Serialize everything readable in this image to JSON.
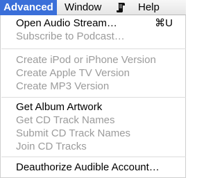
{
  "menubar": {
    "items": [
      {
        "label": "Advanced"
      },
      {
        "label": "Window"
      },
      {
        "label": "Help"
      }
    ],
    "script_icon": "script-scroll-icon"
  },
  "menu": {
    "group1": {
      "open_audio_stream": {
        "label": "Open Audio Stream…",
        "shortcut": "⌘U",
        "enabled": true
      },
      "subscribe_podcast": {
        "label": "Subscribe to Podcast…",
        "enabled": false
      }
    },
    "group2": {
      "create_ipod": {
        "label": "Create iPod or iPhone Version",
        "enabled": false
      },
      "create_appletv": {
        "label": "Create Apple TV Version",
        "enabled": false
      },
      "create_mp3": {
        "label": "Create MP3 Version",
        "enabled": false
      }
    },
    "group3": {
      "get_album_artwork": {
        "label": "Get Album Artwork",
        "enabled": true
      },
      "get_cd_track_names": {
        "label": "Get CD Track Names",
        "enabled": false
      },
      "submit_cd_track_names": {
        "label": "Submit CD Track Names",
        "enabled": false
      },
      "join_cd_tracks": {
        "label": "Join CD Tracks",
        "enabled": false
      }
    },
    "group4": {
      "deauthorize": {
        "label": "Deauthorize Audible Account…",
        "enabled": true
      }
    }
  },
  "colors": {
    "highlight": "#3a6fd9",
    "disabled_text": "#9b9b9b",
    "separator": "#dcdcdc"
  }
}
